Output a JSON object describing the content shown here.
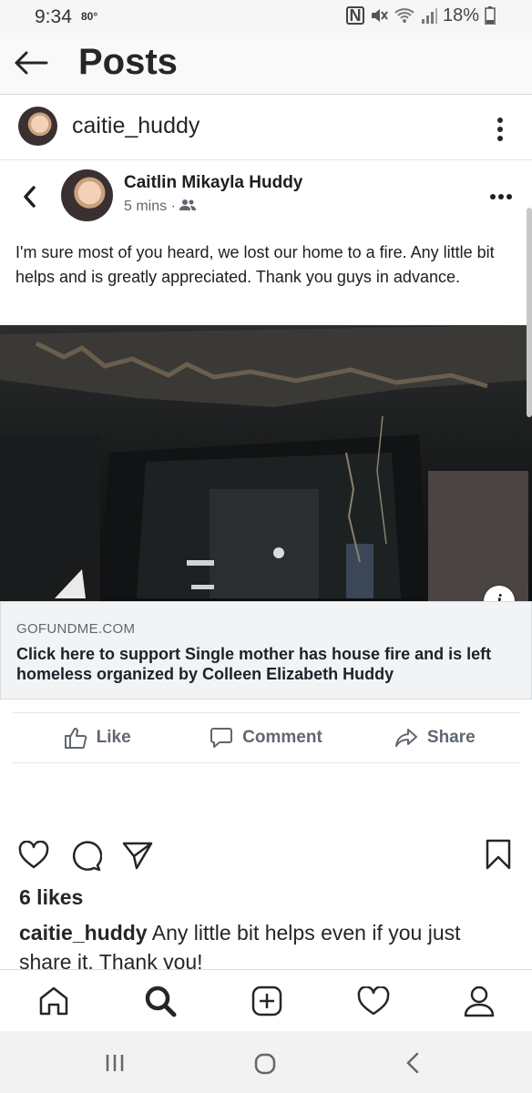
{
  "status_bar": {
    "time": "9:34",
    "temperature": "80°",
    "battery": "18%",
    "icons": [
      "nfc-icon",
      "mute-icon",
      "wifi-icon",
      "signal-icon",
      "battery-icon"
    ]
  },
  "header": {
    "title": "Posts",
    "back_icon": "back-arrow-icon"
  },
  "profile": {
    "username": "caitie_huddy",
    "menu_icon": "vertical-dots-icon"
  },
  "fb_post": {
    "author": "Caitlin Mikayla Huddy",
    "time": "5 mins · ",
    "audience_icon": "friends-icon",
    "text": "I'm sure most of you heard, we lost our home to a fire. Any little bit helps and is greatly appreciated. Thank you guys in advance.",
    "link": {
      "domain": "GOFUNDME.COM",
      "title": "Click here to support Single mother has house fire and is left homeless organized by Colleen Elizabeth Huddy"
    },
    "actions": {
      "like": "Like",
      "comment": "Comment",
      "share": "Share"
    }
  },
  "ig_post": {
    "likes": "6 likes",
    "caption_user": "caitie_huddy",
    "caption_text": " Any little bit helps even if you just share it. Thank you!"
  },
  "bottom_nav": [
    "home-icon",
    "search-icon",
    "add-post-icon",
    "activity-heart-icon",
    "profile-icon"
  ],
  "colors": {
    "text": "#262626",
    "fb_text": "#1c1e21",
    "fb_meta": "#606770",
    "link_bg": "#f2f3f5"
  }
}
